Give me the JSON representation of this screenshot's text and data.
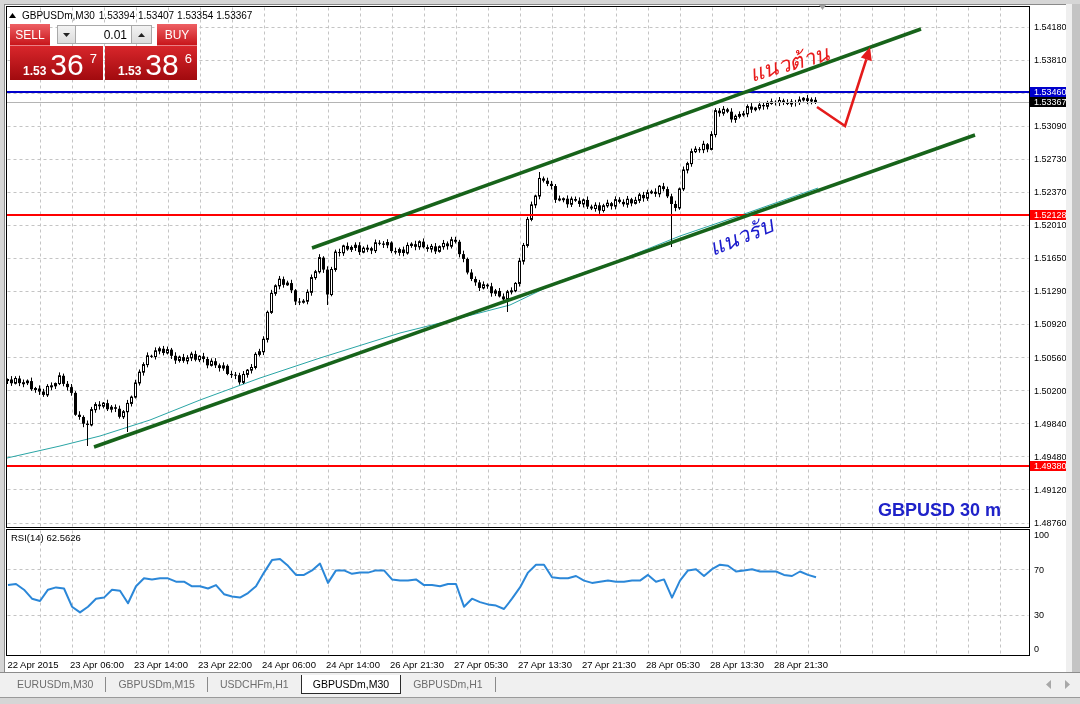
{
  "header": {
    "symbol": "GBPUSDm,M30",
    "prices": [
      "1.53394",
      "1.53407",
      "1.53354",
      "1.53367"
    ]
  },
  "trade_panel": {
    "sell": {
      "label": "SELL",
      "price_prefix": "1.53",
      "price_main": "36",
      "price_super": "7"
    },
    "lot": {
      "value": "0.01"
    },
    "buy": {
      "label": "BUY",
      "price_prefix": "1.53",
      "price_main": "38",
      "price_super": "6"
    }
  },
  "price_chart": {
    "price_axis": [
      "1.54180",
      "1.53810",
      "1.53090",
      "1.52730",
      "1.52370",
      "1.52010",
      "1.51650",
      "1.51290",
      "1.50920",
      "1.50560",
      "1.50200",
      "1.49840",
      "1.49480",
      "1.49120",
      "1.48760"
    ],
    "levels": [
      {
        "kind": "line",
        "label": "1.53460",
        "color": "#0000cc"
      },
      {
        "kind": "bid",
        "label": "1.53367",
        "color": "#000000"
      },
      {
        "kind": "line",
        "label": "1.52128",
        "color": "#ff0000"
      },
      {
        "kind": "line",
        "label": "1.49380",
        "color": "#ff0000"
      }
    ],
    "annotations": [
      {
        "kind": "resistance",
        "text": "แนวต้าน",
        "color": "#e81c1c"
      },
      {
        "kind": "support",
        "text": "แนวรับ",
        "color": "#1a1acc"
      }
    ],
    "caption": "GBPUSD 30 m"
  },
  "rsi": {
    "value": "62.5626",
    "chart_data": {
      "type": "line",
      "grid": true,
      "ylim": [
        -6,
        105
      ],
      "yticks": [
        0,
        30,
        70,
        100
      ],
      "categories": [
        null,
        null,
        null,
        "22 Apr 2015",
        null,
        null,
        null,
        null,
        null,
        null,
        null,
        "23 Apr 06:00",
        null,
        null,
        null,
        null,
        null,
        null,
        null,
        "23 Apr 14:00",
        null,
        null,
        null,
        null,
        null,
        null,
        null,
        "23 Apr 22:00",
        null,
        null,
        null,
        null,
        null,
        null,
        null,
        "24 Apr 06:00",
        null,
        null,
        null,
        null,
        null,
        null,
        null,
        "24 Apr 14:00",
        null,
        null,
        null,
        null,
        null,
        null,
        null,
        "26 Apr 21:30",
        null,
        null,
        null,
        null,
        null,
        null,
        null,
        "27 Apr 05:30",
        null,
        null,
        null,
        null,
        null,
        null,
        null,
        "27 Apr 13:30",
        null,
        null,
        null,
        null,
        null,
        null,
        null,
        "27 Apr 21:30",
        null,
        null,
        null,
        null,
        null,
        null,
        null,
        "28 Apr 05:30",
        null,
        null,
        null,
        null,
        null,
        null,
        null,
        "28 Apr 13:30",
        null,
        null,
        null,
        null,
        null,
        null,
        null,
        "28 Apr 21:30",
        null,
        null
      ],
      "series": [
        {
          "name": "RSI(14)",
          "color": "#2b87d8",
          "values": [
            56,
            57,
            52,
            44,
            42,
            52,
            54,
            53,
            37,
            32,
            37,
            44,
            45,
            52,
            51,
            40,
            55,
            62,
            61,
            62,
            62,
            59,
            59,
            55,
            55,
            53,
            56,
            48,
            46,
            45,
            49,
            55,
            67,
            78,
            79,
            73,
            65,
            65,
            69,
            75,
            58,
            69,
            69,
            66,
            67,
            67,
            69,
            69,
            61,
            60,
            60,
            61,
            56,
            56,
            55,
            57,
            57,
            37,
            44,
            41,
            39,
            38,
            35,
            44,
            54,
            67,
            74,
            74,
            63,
            62,
            62,
            64,
            60,
            58,
            59,
            60,
            59,
            59,
            60,
            60,
            65,
            59,
            61,
            45,
            60,
            69,
            70,
            64,
            70,
            74,
            73,
            68,
            69,
            70,
            68,
            68,
            68,
            65,
            64,
            68,
            65,
            63
          ]
        }
      ]
    }
  },
  "tabs": [
    {
      "label": "EURUSDm,M30",
      "selected": false
    },
    {
      "label": "GBPUSDm,M15",
      "selected": false
    },
    {
      "label": "USDCHFm,H1",
      "selected": false
    },
    {
      "label": "GBPUSDm,M30",
      "selected": true
    },
    {
      "label": "GBPUSDm,H1",
      "selected": false
    }
  ]
}
